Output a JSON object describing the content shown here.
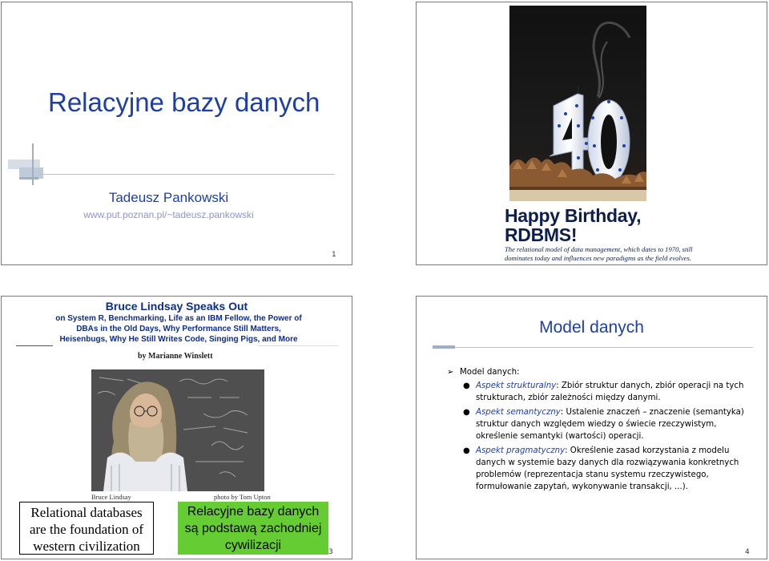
{
  "slide1": {
    "title": "Relacyjne bazy danych",
    "author": "Tadeusz Pankowski",
    "url": "www.put.poznan.pl/~tadeusz.pankowski",
    "page_number": "1"
  },
  "slide2": {
    "image_alt": "Birthday cake with number 40 candles",
    "heading_line1": "Happy Birthday,",
    "heading_line2": "RDBMS!",
    "subtitle_line1": "The relational model of data management, which dates to 1970, still",
    "subtitle_line2": "dominates today and influences new paradigms as the field evolves."
  },
  "slide3": {
    "heading": "Bruce Lindsay Speaks Out",
    "subheading_line1": "on System R, Benchmarking, Life as an IBM Fellow, the Power of",
    "subheading_line2": "DBAs in the Old Days, Why Performance Still Matters,",
    "subheading_line3": "Heisenbugs, Why He Still Writes Code, Singing Pigs, and More",
    "byline": "by Marianne Winslett",
    "photo_caption_left": "Bruce Lindsay",
    "photo_caption_right": "photo by Tom Upton",
    "quote_en_line1": "Relational databases",
    "quote_en_line2": "are the foundation of",
    "quote_en_line3": "western civilization",
    "quote_pl_line1": "Relacyjne bazy danych",
    "quote_pl_line2": "są podstawą zachodniej",
    "quote_pl_line3": "cywilizacji",
    "page_number": "3"
  },
  "slide4": {
    "title": "Model danych",
    "bullet_main": "Model danych:",
    "items": [
      {
        "term": "Aspekt strukturalny",
        "text": ": Zbiór struktur danych, zbiór operacji na tych strukturach, zbiór zależności między danymi."
      },
      {
        "term": "Aspekt semantyczny",
        "text": ": Ustalenie znaczeń – znaczenie (semantyka) struktur danych względem wiedzy o świecie rzeczywistym, określenie semantyki (wartości) operacji."
      },
      {
        "term": "Aspekt pragmatyczny",
        "text": ": Określenie zasad korzystania z modelu danych w systemie bazy danych dla rozwiązywania konkretnych problemów (reprezentacja stanu systemu rzeczywistego, formułowanie zapytań, wykonywanie transakcji, ...)."
      }
    ],
    "page_number": "4"
  }
}
